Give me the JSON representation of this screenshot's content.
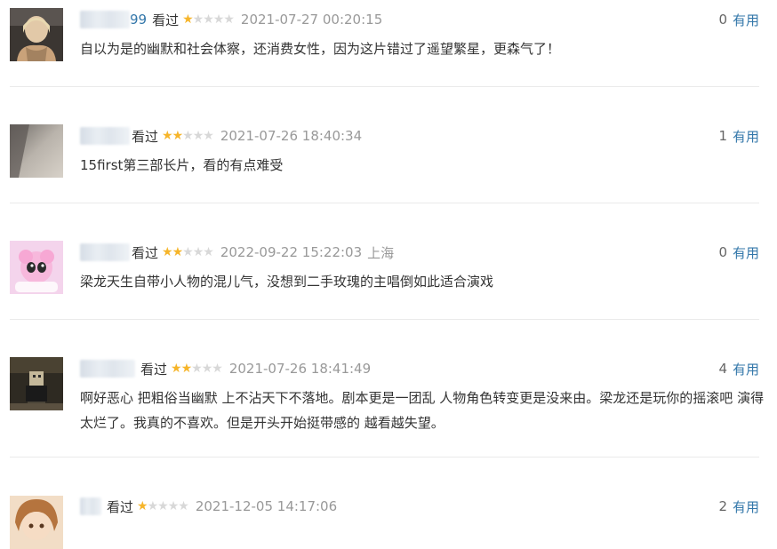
{
  "comments": [
    {
      "username_visible": "99",
      "seen_label": "看过",
      "rating": 1,
      "date": "2021-07-27 00:20:15",
      "location": "",
      "useful_count": "0",
      "useful_label": "有用",
      "text": "自以为是的幽默和社会体察，还消费女性，因为这片错过了遥望繁星，更森气了！"
    },
    {
      "username_visible": "",
      "seen_label": "看过",
      "rating": 2,
      "date": "2021-07-26 18:40:34",
      "location": "",
      "useful_count": "1",
      "useful_label": "有用",
      "text": "15first第三部长片，看的有点难受"
    },
    {
      "username_visible": "",
      "seen_label": "看过",
      "rating": 2,
      "date": "2022-09-22 15:22:03",
      "location": "上海",
      "useful_count": "0",
      "useful_label": "有用",
      "text": "梁龙天生自带小人物的混儿气，没想到二手玫瑰的主唱倒如此适合演戏"
    },
    {
      "username_visible": "",
      "seen_label": "看过",
      "rating": 2,
      "date": "2021-07-26 18:41:49",
      "location": "",
      "useful_count": "4",
      "useful_label": "有用",
      "text": "啊好恶心 把粗俗当幽默 上不沾天下不落地。剧本更是一团乱 人物角色转变更是没来由。梁龙还是玩你的摇滚吧 演得太烂了。我真的不喜欢。但是开头开始挺带感的 越看越失望。"
    },
    {
      "username_visible": "",
      "seen_label": "看过",
      "rating": 1,
      "date": "2021-12-05 14:17:06",
      "location": "",
      "useful_count": "2",
      "useful_label": "有用",
      "text": ""
    }
  ],
  "colors": {
    "link": "#3377aa",
    "star_on": "#f6b52a",
    "star_off": "#d8d8d8",
    "meta_gray": "#999999",
    "divider": "#eaeaea"
  }
}
